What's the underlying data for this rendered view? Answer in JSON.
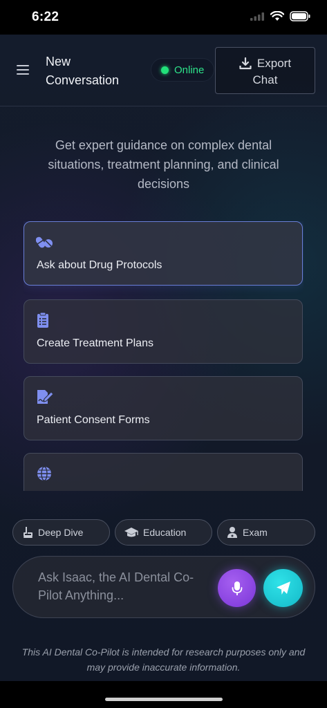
{
  "status_bar": {
    "time": "6:22"
  },
  "header": {
    "menu_icon": "hamburger-menu-icon",
    "title": "New Conversation",
    "status": "Online",
    "status_color": "#22e07a",
    "export_label_line1": "Export",
    "export_label_line2": "Chat",
    "export_icon": "download-icon"
  },
  "intro": "Get expert guidance on complex dental situations, treatment planning, and clinical decisions",
  "cards": [
    {
      "icon": "pills-icon",
      "label": "Ask about Drug Protocols"
    },
    {
      "icon": "clipboard-list-icon",
      "label": "Create Treatment Plans"
    },
    {
      "icon": "signature-document-icon",
      "label": "Patient Consent Forms"
    },
    {
      "icon": "globe-icon",
      "label": ""
    }
  ],
  "chips": [
    {
      "icon": "tooth-brush-icon",
      "label": "Deep Dive"
    },
    {
      "icon": "graduation-cap-icon",
      "label": "Education"
    },
    {
      "icon": "doctor-icon",
      "label": "Exam"
    }
  ],
  "composer": {
    "placeholder": "Ask Isaac, the AI Dental Co-Pilot Anything...",
    "mic_icon": "microphone-icon",
    "send_icon": "paper-plane-icon",
    "mic_color": "#8e45e6",
    "send_color": "#1ccdd8"
  },
  "disclaimer": "This AI Dental Co-Pilot is intended for research purposes only and may provide inaccurate information.",
  "accent_color": "#6a7fe6"
}
